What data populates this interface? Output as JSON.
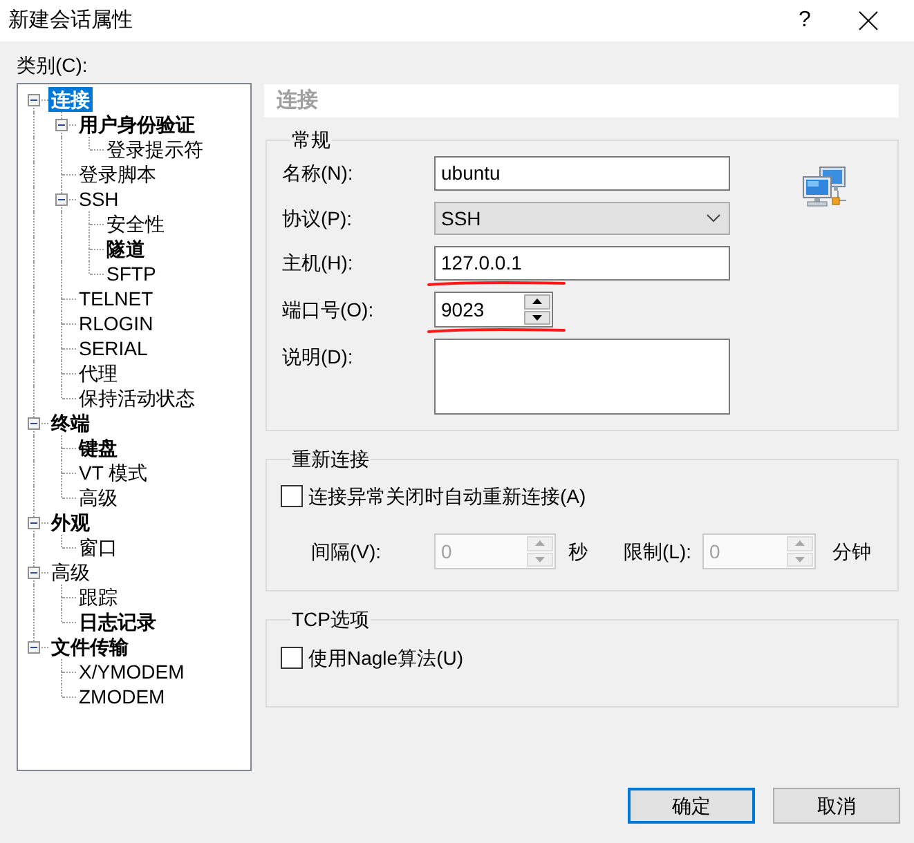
{
  "window": {
    "title": "新建会话属性",
    "help_button": "?"
  },
  "category_label": "类别(C):",
  "tree": [
    {
      "label": "连接",
      "bold": true,
      "selected": true,
      "expanded": true,
      "children": [
        {
          "label": "用户身份验证",
          "bold": true,
          "selected": false,
          "expanded": true,
          "children": [
            {
              "label": "登录提示符",
              "bold": false,
              "selected": false
            }
          ]
        },
        {
          "label": "登录脚本",
          "bold": false,
          "selected": false
        },
        {
          "label": "SSH",
          "bold": false,
          "selected": false,
          "expanded": true,
          "children": [
            {
              "label": "安全性",
              "bold": false,
              "selected": false
            },
            {
              "label": "隧道",
              "bold": true,
              "selected": false
            },
            {
              "label": "SFTP",
              "bold": false,
              "selected": false
            }
          ]
        },
        {
          "label": "TELNET",
          "bold": false,
          "selected": false
        },
        {
          "label": "RLOGIN",
          "bold": false,
          "selected": false
        },
        {
          "label": "SERIAL",
          "bold": false,
          "selected": false
        },
        {
          "label": "代理",
          "bold": false,
          "selected": false
        },
        {
          "label": "保持活动状态",
          "bold": false,
          "selected": false
        }
      ]
    },
    {
      "label": "终端",
      "bold": true,
      "selected": false,
      "expanded": true,
      "children": [
        {
          "label": "键盘",
          "bold": true,
          "selected": false
        },
        {
          "label": "VT 模式",
          "bold": false,
          "selected": false
        },
        {
          "label": "高级",
          "bold": false,
          "selected": false
        }
      ]
    },
    {
      "label": "外观",
      "bold": true,
      "selected": false,
      "expanded": true,
      "children": [
        {
          "label": "窗口",
          "bold": false,
          "selected": false
        }
      ]
    },
    {
      "label": "高级",
      "bold": false,
      "selected": false,
      "expanded": true,
      "children": [
        {
          "label": "跟踪",
          "bold": false,
          "selected": false
        },
        {
          "label": "日志记录",
          "bold": true,
          "selected": false
        }
      ]
    },
    {
      "label": "文件传输",
      "bold": true,
      "selected": false,
      "expanded": true,
      "children": [
        {
          "label": "X/YMODEM",
          "bold": false,
          "selected": false
        },
        {
          "label": "ZMODEM",
          "bold": false,
          "selected": false
        }
      ]
    }
  ],
  "panel": {
    "title": "连接",
    "general": {
      "title": "常规",
      "fields": [
        {
          "kind": "text",
          "label": "名称(N):",
          "value": "ubuntu",
          "underlined": false
        },
        {
          "kind": "select",
          "label": "协议(P):",
          "value": "SSH",
          "underlined": false
        },
        {
          "kind": "text",
          "label": "主机(H):",
          "value": "127.0.0.1",
          "underlined": true
        },
        {
          "kind": "spin",
          "label": "端口号(O):",
          "value": "9023",
          "underlined": true
        },
        {
          "kind": "textarea",
          "label": "说明(D):",
          "underlined": false
        }
      ]
    },
    "reconnect": {
      "title": "重新连接",
      "checkbox": {
        "label": "连接异常关闭时自动重新连接(A)",
        "checked": false
      },
      "interval": {
        "label": "间隔(V):",
        "value": "0",
        "unit": "秒",
        "disabled": true
      },
      "limit": {
        "label": "限制(L):",
        "value": "0",
        "unit": "分钟",
        "disabled": true
      }
    },
    "tcp": {
      "title": "TCP选项",
      "checkbox": {
        "label": "使用Nagle算法(U)",
        "checked": false
      }
    }
  },
  "buttons": [
    {
      "label": "确定",
      "default": true
    },
    {
      "label": "取消",
      "default": false
    }
  ]
}
